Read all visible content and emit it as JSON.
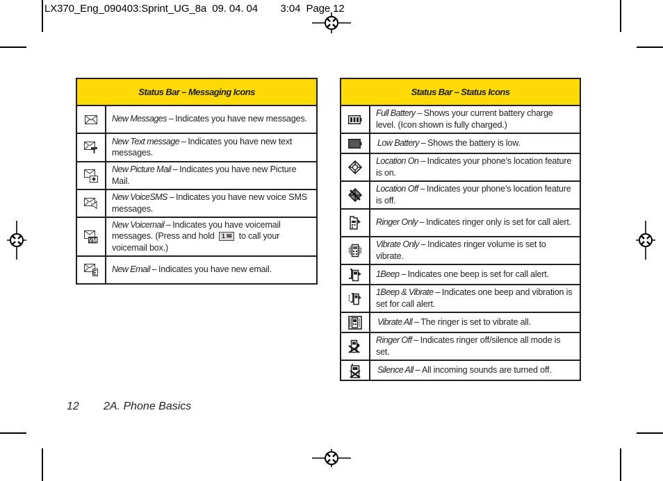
{
  "slug": {
    "text": "LX370_Eng_090403:Sprint_UG_8a  09. 04. 04        3:04  Page 12"
  },
  "messaging_table": {
    "title": "Status Bar – Messaging Icons",
    "rows": [
      {
        "icon": "envelope-icon",
        "term": "New Messages – ",
        "desc": "Indicates you have new messages."
      },
      {
        "icon": "text-message-icon",
        "term": "New Text message – ",
        "desc": "Indicates you have new text messages."
      },
      {
        "icon": "picture-mail-icon",
        "term": "New Picture Mail – ",
        "desc": "Indicates you have new Picture Mail."
      },
      {
        "icon": "voice-sms-icon",
        "term": "New VoiceSMS – ",
        "desc": "Indicates you have new voice SMS messages."
      },
      {
        "icon": "voicemail-icon",
        "term": "New Voicemail – ",
        "desc_before": "Indicates you have voicemail messages. (Press and hold ",
        "key": "1 ✉",
        "desc_after": " to call your voicemail box.)"
      },
      {
        "icon": "email-icon",
        "term": "New Email – ",
        "desc": "Indicates you have new email."
      }
    ]
  },
  "status_table": {
    "title": "Status Bar – Status Icons",
    "rows": [
      {
        "icon": "full-battery-icon",
        "term": "Full Battery – ",
        "desc": "Shows your current battery charge level. (Icon shown is fully charged.)"
      },
      {
        "icon": "low-battery-icon",
        "term": "Low Battery – ",
        "desc": "Shows the battery is low."
      },
      {
        "icon": "location-on-icon",
        "term": "Location On – ",
        "desc": "Indicates your phone’s location feature is on."
      },
      {
        "icon": "location-off-icon",
        "term": "Location Off – ",
        "desc": "Indicates your phone’s location feature is off."
      },
      {
        "icon": "ringer-only-icon",
        "term": "Ringer Only – ",
        "desc": "Indicates ringer only is set for call alert."
      },
      {
        "icon": "vibrate-only-icon",
        "term": "Vibrate Only – ",
        "desc": "Indicates ringer volume is set to vibrate."
      },
      {
        "icon": "one-beep-icon",
        "term": "1Beep – ",
        "desc": "Indicates one beep is set for call alert."
      },
      {
        "icon": "one-beep-vibrate-icon",
        "term": "1Beep & Vibrate – ",
        "desc": "Indicates one beep and vibration is set for call alert."
      },
      {
        "icon": "vibrate-all-icon",
        "term": "Vibrate All – ",
        "desc": "The ringer is set to vibrate all."
      },
      {
        "icon": "ringer-off-icon",
        "term": "Ringer Off – ",
        "desc": "Indicates ringer off/silence all mode is set."
      },
      {
        "icon": "silence-all-icon",
        "term": "Silence All – ",
        "desc": "All incoming sounds are turned off."
      }
    ]
  },
  "footer": {
    "page_number": "12",
    "section": "2A. Phone Basics"
  },
  "colors": {
    "header_yellow": "#fdd907",
    "rule": "#231f20"
  }
}
